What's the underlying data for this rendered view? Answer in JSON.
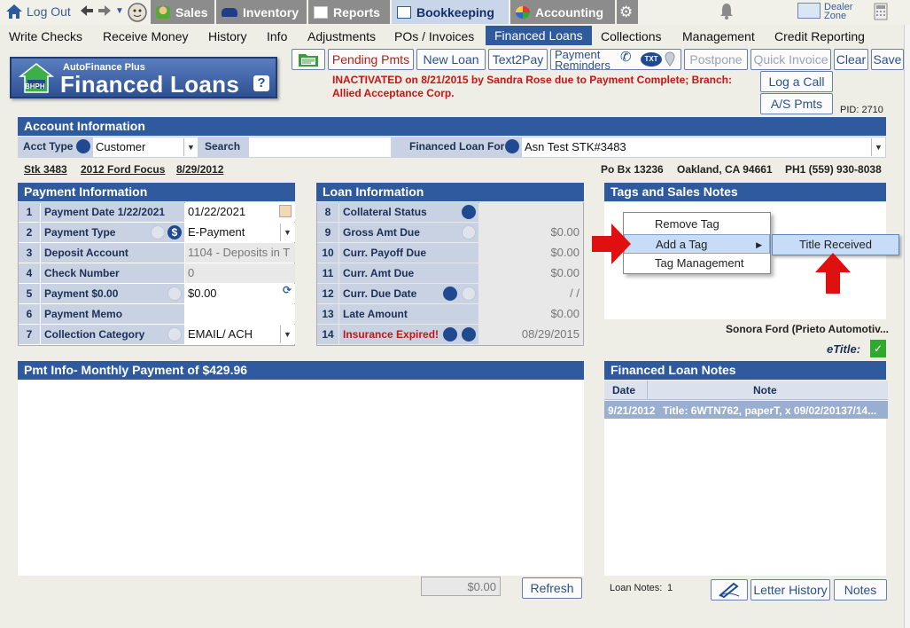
{
  "nav": {
    "logout": "Log Out",
    "modules": [
      "Sales",
      "Inventory",
      "Reports",
      "Bookkeeping",
      "Accounting"
    ],
    "dealer_zone_line1": "Dealer",
    "dealer_zone_line2": "Zone"
  },
  "submenu": [
    "Write Checks",
    "Receive Money",
    "History",
    "Info",
    "Adjustments",
    "POs / Invoices",
    "Financed Loans",
    "Collections",
    "Management",
    "Credit Reporting"
  ],
  "logo": {
    "small": "AutoFinance Plus",
    "big": "Financed Loans",
    "badge": "BHPH",
    "help": "?"
  },
  "toolbar": {
    "pending": "Pending Pmts",
    "new_loan": "New Loan",
    "text2pay": "Text2Pay",
    "reminders_l1": "Payment",
    "reminders_l2": "Reminders",
    "txt": "TXT",
    "postpone": "Postpone",
    "quick_invoice": "Quick Invoice",
    "clear": "Clear",
    "save": "Save",
    "log_call": "Log a Call",
    "as_pmts": "A/S Pmts"
  },
  "status": {
    "inactive_line1": "INACTIVATED on 8/21/2015 by Sandra Rose due to Payment Complete; Branch:",
    "inactive_line2": "Allied Acceptance Corp.",
    "pid": "PID: 2710"
  },
  "account": {
    "header": "Account Information",
    "acct_type_label": "Acct Type",
    "acct_type_value": "Customer",
    "search_label": "Search",
    "search_value": "",
    "loan_for_label": "Financed Loan For",
    "loan_for_value": "Asn Test STK#3483",
    "stock": "Stk 3483",
    "vehicle": "2012 Ford Focus",
    "date": "8/29/2012",
    "address": "Po Bx 13236",
    "city": "Oakland, CA 94661",
    "phone": "PH1 (559) 930-8038"
  },
  "payment": {
    "header": "Payment Information",
    "rows": [
      {
        "num": "1",
        "label": "Payment Date  1/22/2021",
        "value": "01/22/2021"
      },
      {
        "num": "2",
        "label": "Payment Type",
        "value": "E-Payment"
      },
      {
        "num": "3",
        "label": "Deposit Account",
        "value": "1104 - Deposits in T"
      },
      {
        "num": "4",
        "label": "Check Number",
        "value": "0"
      },
      {
        "num": "5",
        "label": "Payment  $0.00",
        "value": "$0.00"
      },
      {
        "num": "6",
        "label": "Payment Memo",
        "value": ""
      },
      {
        "num": "7",
        "label": "Collection Category",
        "value": "EMAIL/ ACH"
      }
    ]
  },
  "loan": {
    "header": "Loan Information",
    "rows": [
      {
        "num": "8",
        "label": "Collateral Status",
        "value": ""
      },
      {
        "num": "9",
        "label": "Gross Amt Due",
        "value": "$0.00"
      },
      {
        "num": "10",
        "label": "Curr. Payoff Due",
        "value": "$0.00"
      },
      {
        "num": "11",
        "label": "Curr. Amt Due",
        "value": "$0.00"
      },
      {
        "num": "12",
        "label": "Curr. Due Date",
        "value": "/  /"
      },
      {
        "num": "13",
        "label": "Late Amount",
        "value": "$0.00"
      },
      {
        "num": "14",
        "label": "Insurance Expired!",
        "value": "08/29/2015"
      }
    ]
  },
  "tags": {
    "header": "Tags and Sales Notes",
    "menu": [
      "Remove Tag",
      "Add a Tag",
      "Tag Management"
    ],
    "submenu_item": "Title Received",
    "dealer": "Sonora Ford (Prieto Automotiv...",
    "etitle": "eTitle:"
  },
  "pmt_info": {
    "header": "Pmt Info- Monthly Payment of $429.96",
    "total": "$0.00",
    "refresh": "Refresh"
  },
  "notes": {
    "header": "Financed Loan Notes",
    "col_date": "Date",
    "col_note": "Note",
    "rows": [
      {
        "date": "9/21/2012",
        "note": "Title:  6WTN762, paperT,  x 09/02/20137/14..."
      }
    ],
    "count_label": "Loan Notes:",
    "count": "1",
    "letter_history": "Letter History",
    "notes_btn": "Notes"
  },
  "colors": {
    "header_blue": "#2f5b9e",
    "label_bg": "#c9d2e3",
    "alert_red": "#c81414",
    "arrow_red": "#e01010",
    "check_green": "#2ea92e"
  }
}
